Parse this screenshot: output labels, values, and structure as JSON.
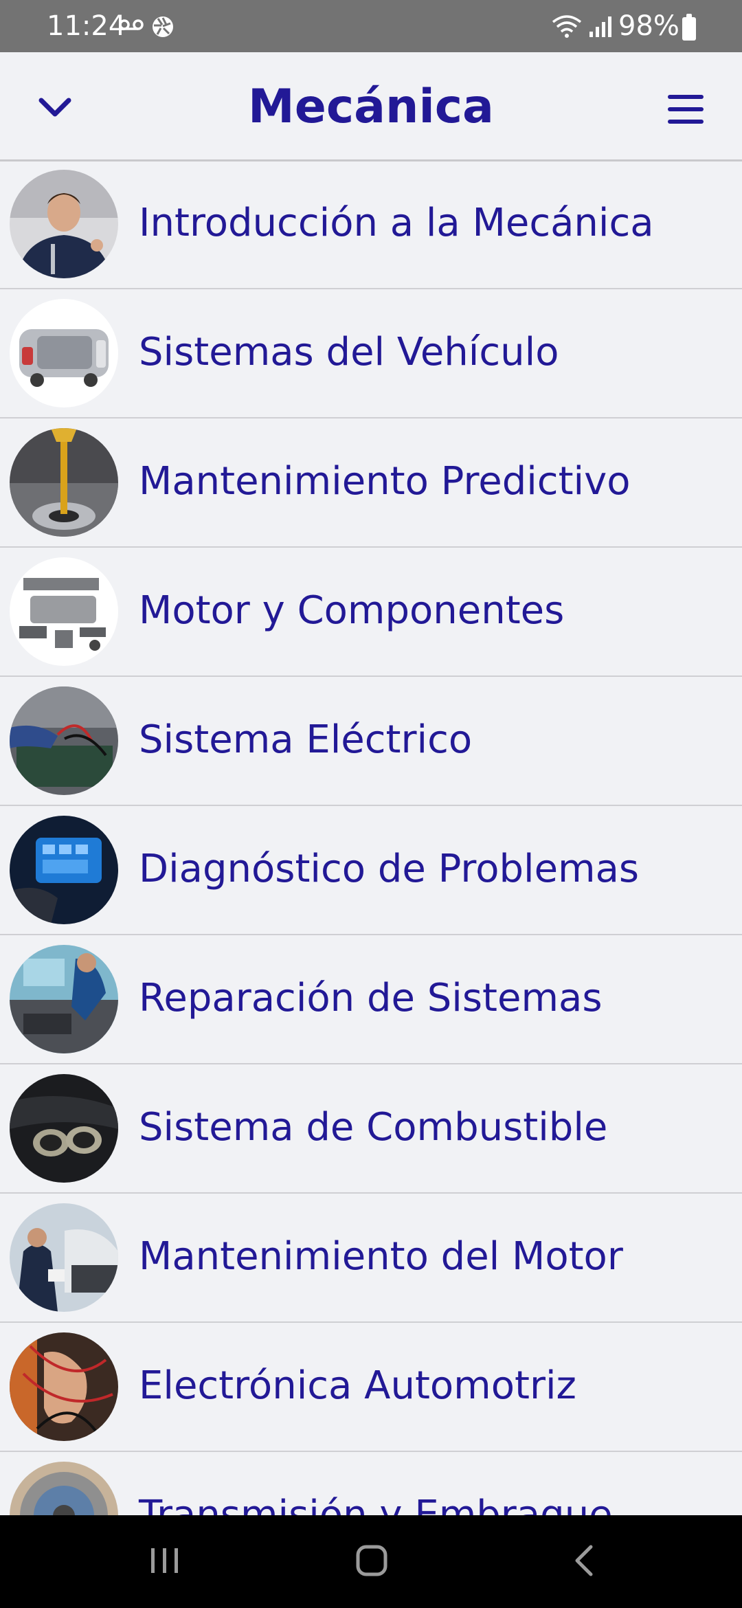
{
  "status_bar": {
    "time": "11:24",
    "battery": "98%",
    "icons": [
      "voicemail-icon",
      "aperture-icon",
      "wifi-icon",
      "signal-icon",
      "battery-icon"
    ]
  },
  "header": {
    "title": "Mecánica",
    "left_icon": "chevron-down-icon",
    "right_icon": "hamburger-menu-icon"
  },
  "items": [
    {
      "label": "Introducción a la Mecánica",
      "thumb": "mechanic-portrait"
    },
    {
      "label": "Sistemas del Vehículo",
      "thumb": "car-chassis"
    },
    {
      "label": "Mantenimiento Predictivo",
      "thumb": "oil-pour"
    },
    {
      "label": "Motor y Componentes",
      "thumb": "engine-parts"
    },
    {
      "label": "Sistema Eléctrico",
      "thumb": "multimeter-battery"
    },
    {
      "label": "Diagnóstico de Problemas",
      "thumb": "diagnostic-tablet"
    },
    {
      "label": "Reparación de Sistemas",
      "thumb": "engine-repair"
    },
    {
      "label": "Sistema de Combustible",
      "thumb": "exhaust-pipes"
    },
    {
      "label": "Mantenimiento del Motor",
      "thumb": "workshop-mechanic"
    },
    {
      "label": "Electrónica Automotriz",
      "thumb": "multimeter-probes"
    },
    {
      "label": "Transmisión y Embrague",
      "thumb": "clutch-disc"
    }
  ],
  "colors": {
    "accent": "#221996",
    "background": "#f1f2f5",
    "status_bar": "#737373",
    "nav_bar": "#000000"
  },
  "nav_bar": {
    "icons": [
      "recents-icon",
      "home-icon",
      "back-icon"
    ]
  }
}
